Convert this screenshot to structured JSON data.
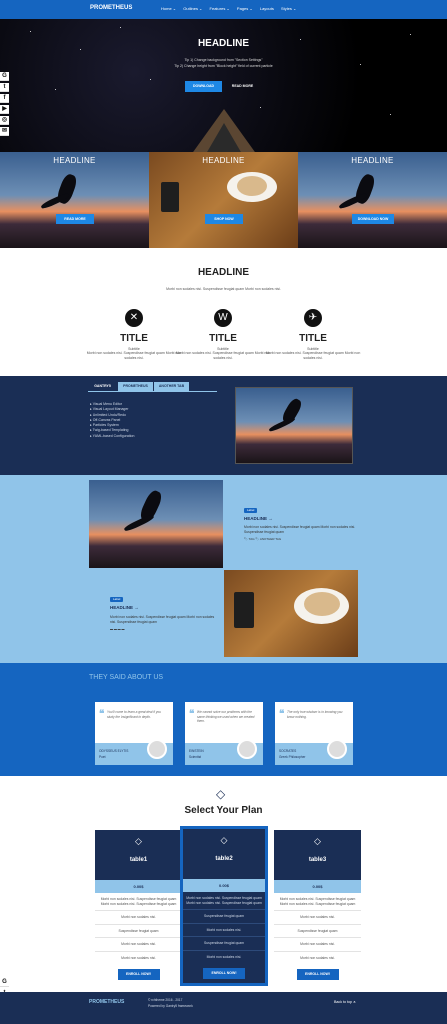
{
  "nav": {
    "brand": "PROMETHEUS",
    "items": [
      "Home ⌄",
      "Outlines ⌄",
      "Features ⌄",
      "Pages ⌄",
      "Layouts",
      "Styles ⌄"
    ]
  },
  "hero": {
    "headline": "HEADLINE",
    "tip1": "Tip 1) Change background from \"Section Settings\"",
    "tip2": "Tip 2) Change height from \"Block height\" field of current particle",
    "btn1": "DOWNLOAD",
    "btn2": "READ MORE"
  },
  "social": {
    "items": [
      "G",
      "t",
      "f",
      "▶",
      "◎",
      "✉"
    ],
    "items_bottom": [
      "G",
      "t",
      "f"
    ]
  },
  "tiles": [
    {
      "title": "HEADLINE",
      "button": "READ MORE"
    },
    {
      "title": "HEADLINE",
      "button": "SHOP NOW"
    },
    {
      "title": "HEADLINE",
      "button": "DOWNLOAD NOW"
    }
  ],
  "features": {
    "headline": "HEADLINE",
    "subtitle": "Morbi non sodales nisi. Suspendisse feugiat quam Morbi non sodales nisi.",
    "items": [
      {
        "icon": "✕",
        "title": "TITLE",
        "subtitle": "Subtitle",
        "desc": "Morbi non sodales nisi. Suspendisse feugiat quam Morbi non sodales nisi."
      },
      {
        "icon": "W",
        "title": "TITLE",
        "subtitle": "Subtitle",
        "desc": "Morbi non sodales nisi. Suspendisse feugiat quam Morbi non sodales nisi."
      },
      {
        "icon": "✈",
        "title": "TITLE",
        "subtitle": "Subtitle",
        "desc": "Morbi non sodales nisi. Suspendisse feugiat quam Morbi non sodales nisi."
      }
    ]
  },
  "tabs": {
    "items": [
      "GANTRY5",
      "PROMETHEUS",
      "ANOTHER TAB"
    ],
    "list": [
      "Visual Menu Editor",
      "Visual Layout Manager",
      "Unlimited Undo/Redo",
      "Off-Canvas Panel",
      "Particles System",
      "Twig-based Templating",
      "YAML-based Configuration"
    ]
  },
  "posts": [
    {
      "badge": "Label",
      "title": "HEADLINE →",
      "text": "Morbi non sodales nisi. Suspendisse feugiat quam Morbi non sodales nisi. Suspendisse feugiat quam",
      "tags": "🏷 TAG  🏷 ANOTHER TAG"
    },
    {
      "badge": "Label",
      "title": "HEADLINE →",
      "text": "Morbi non sodales nisi. Suspendisse feugiat quam Morbi non sodales nisi. Suspendisse feugiat quam",
      "tags": "▬ ▬ ▬ ▬"
    }
  ],
  "testimonials": {
    "title": "THEY SAID ABOUT US",
    "items": [
      {
        "text": "You'll come to learn a great deal if you study the Insignificant in depth.",
        "name": "ODYSSEUS ELYTIS",
        "role": "Poet"
      },
      {
        "text": "We cannot solve our problems with the same thinking we used when we created them.",
        "name": "EINSTEIN",
        "role": "Scientist"
      },
      {
        "text": "The only true wisdom is in knowing you know nothing.",
        "name": "SOCRATES",
        "role": "Greek Philosopher"
      }
    ]
  },
  "pricing": {
    "title": "Select Your Plan",
    "plans": [
      {
        "name": "table1",
        "price": "0.00$",
        "desc": "Morbi non sodales nisi. Suspendisse feugiat quam Morbi non sodales nisi. Suspendisse feugiat quam",
        "items": [
          "Morbi non sodales nisi.",
          "Suspendisse feugiat quam",
          "Morbi non sodales nisi.",
          "Morbi non sodales nisi."
        ],
        "button": "ENROLL NOW!"
      },
      {
        "name": "table2",
        "price": "0.00$",
        "desc": "Morbi non sodales nisi. Suspendisse feugiat quam Morbi non sodales nisi. Suspendisse feugiat quam",
        "items": [
          "Suspendisse feugiat quam",
          "Morbi non sodales nisi.",
          "Suspendisse feugiat quam",
          "Morbi non sodales nisi."
        ],
        "button": "ENROLL NOW!"
      },
      {
        "name": "table3",
        "price": "0.00$",
        "desc": "Morbi non sodales nisi. Suspendisse feugiat quam Morbi non sodales nisi. Suspendisse feugiat quam",
        "items": [
          "Morbi non sodales nisi.",
          "Suspendisse feugiat quam",
          "Morbi non sodales nisi.",
          "Morbi non sodales nisi."
        ],
        "button": "ENROLL NOW!"
      }
    ]
  },
  "footer": {
    "brand": "PROMETHEUS",
    "copyright": "© rchtheme 2016 - 2017",
    "powered": "Powered by Gantry5 framework",
    "back_to_top": "Back to top ⏶"
  },
  "colors": {
    "primary": "#1565c0",
    "navy": "#1a2e55",
    "light": "#90c4e9"
  }
}
